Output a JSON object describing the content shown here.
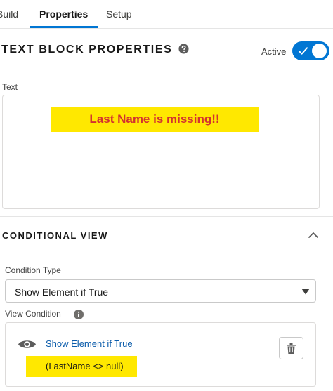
{
  "tabs": [
    {
      "label": "Build"
    },
    {
      "label": "Properties"
    },
    {
      "label": "Setup"
    }
  ],
  "active_tab": "Properties",
  "header": {
    "title": "TEXT BLOCK PROPERTIES",
    "help_icon": "question-circle-icon",
    "active_label": "Active",
    "active": true
  },
  "text_field": {
    "label": "Text",
    "content": "Last Name is missing!!"
  },
  "conditional_view": {
    "title": "CONDITIONAL VIEW",
    "collapse_icon": "chevron-up-icon",
    "condition_type_label": "Condition Type",
    "condition_type_value": "Show Element if True",
    "view_condition_label": "View Condition",
    "info_icon": "info-icon",
    "condition": {
      "icon": "eye-icon",
      "link_text": "Show Element if True",
      "expression": "(LastName <> null)",
      "delete_icon": "trash-icon"
    }
  },
  "colors": {
    "accent": "#0176d3",
    "highlight": "#ffe800",
    "error_text": "#d3322f",
    "link": "#0b5cab"
  }
}
